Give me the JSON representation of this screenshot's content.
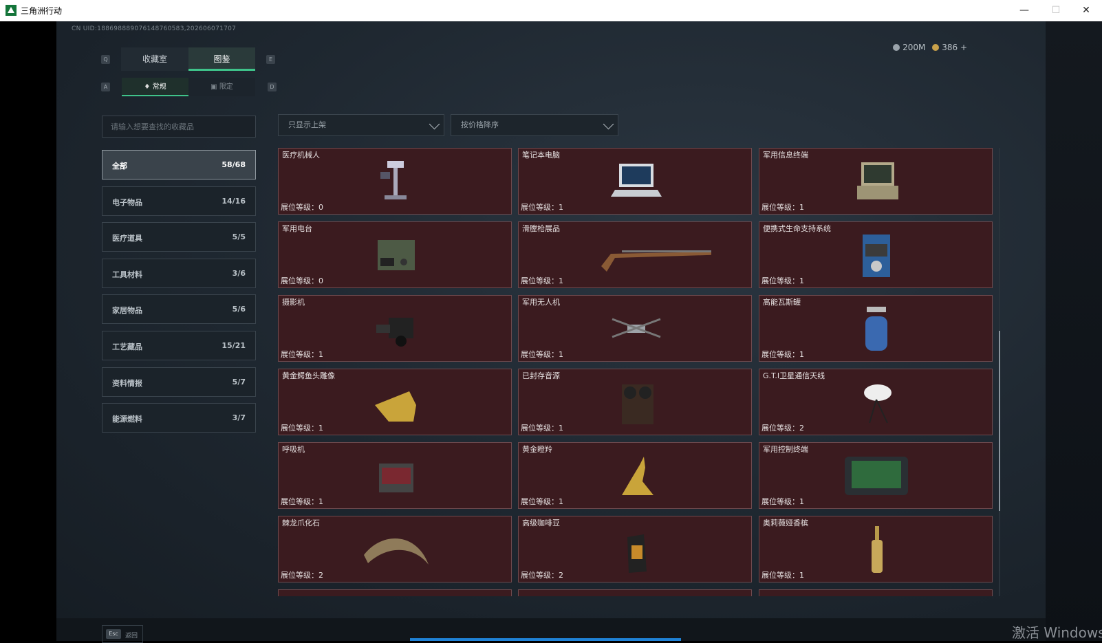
{
  "window": {
    "title": "三角洲行动",
    "minimize": "—",
    "maximize": "☐",
    "close": "✕"
  },
  "header": {
    "uid": "CN UID:18869888907614876058​3,20260607170​7",
    "silver": "200M",
    "gold": "386 +"
  },
  "keys": {
    "q": "Q",
    "e": "E",
    "a": "A",
    "d": "D"
  },
  "tabs": [
    {
      "label": "收藏室"
    },
    {
      "label": "图鉴"
    }
  ],
  "subtabs": [
    {
      "label": "常规"
    },
    {
      "label": "限定"
    }
  ],
  "search": {
    "placeholder": "请输入想要查找的收藏品"
  },
  "filters": {
    "shelf": "只显示上架",
    "sort": "按价格降序"
  },
  "categories": [
    {
      "label": "全部",
      "count": "58/68"
    },
    {
      "label": "电子物品",
      "count": "14/16"
    },
    {
      "label": "医疗道具",
      "count": "5/5"
    },
    {
      "label": "工具材料",
      "count": "3/6"
    },
    {
      "label": "家居物品",
      "count": "5/6"
    },
    {
      "label": "工艺藏品",
      "count": "15/21"
    },
    {
      "label": "资料情报",
      "count": "5/7"
    },
    {
      "label": "能源燃料",
      "count": "3/7"
    }
  ],
  "items": [
    {
      "name": "医疗机械人",
      "level": "展位等级：0",
      "icon": "robot-icon"
    },
    {
      "name": "笔记本电脑",
      "level": "展位等级：1",
      "icon": "laptop-icon"
    },
    {
      "name": "军用信息终端",
      "level": "展位等级：1",
      "icon": "terminal-icon"
    },
    {
      "name": "军用电台",
      "level": "展位等级：0",
      "icon": "radio-icon"
    },
    {
      "name": "滑膛枪展品",
      "level": "展位等级：1",
      "icon": "musket-icon"
    },
    {
      "name": "便携式生命支持系统",
      "level": "展位等级：1",
      "icon": "life-support-icon"
    },
    {
      "name": "摄影机",
      "level": "展位等级：1",
      "icon": "camera-icon"
    },
    {
      "name": "军用无人机",
      "level": "展位等级：1",
      "icon": "drone-icon"
    },
    {
      "name": "高能瓦斯罐",
      "level": "展位等级：1",
      "icon": "gas-tank-icon"
    },
    {
      "name": "黄金鳄鱼头雕像",
      "level": "展位等级：1",
      "icon": "croc-statue-icon"
    },
    {
      "name": "已封存音源",
      "level": "展位等级：1",
      "icon": "reel-player-icon"
    },
    {
      "name": "G.T.I卫星通信天线",
      "level": "展位等级：2",
      "icon": "satellite-dish-icon"
    },
    {
      "name": "呼吸机",
      "level": "展位等级：1",
      "icon": "ventilator-icon"
    },
    {
      "name": "黄金瞪羚",
      "level": "展位等级：1",
      "icon": "gazelle-icon"
    },
    {
      "name": "军用控制终端",
      "level": "展位等级：1",
      "icon": "control-terminal-icon"
    },
    {
      "name": "棘龙爪化石",
      "level": "展位等级：2",
      "icon": "claw-fossil-icon"
    },
    {
      "name": "高级咖啡豆",
      "level": "展位等级：2",
      "icon": "coffee-bag-icon"
    },
    {
      "name": "奥莉薇娅香槟",
      "level": "展位等级：1",
      "icon": "champagne-icon"
    }
  ],
  "footer": {
    "esc_key": "Esc",
    "back": "返回"
  },
  "watermark": "激活 Windows",
  "colors": {
    "accent": "#3fc38a",
    "card_bg": "#3b1b1f",
    "card_border": "#6e4a4e",
    "taskbar_blue": "#1f82d6"
  }
}
